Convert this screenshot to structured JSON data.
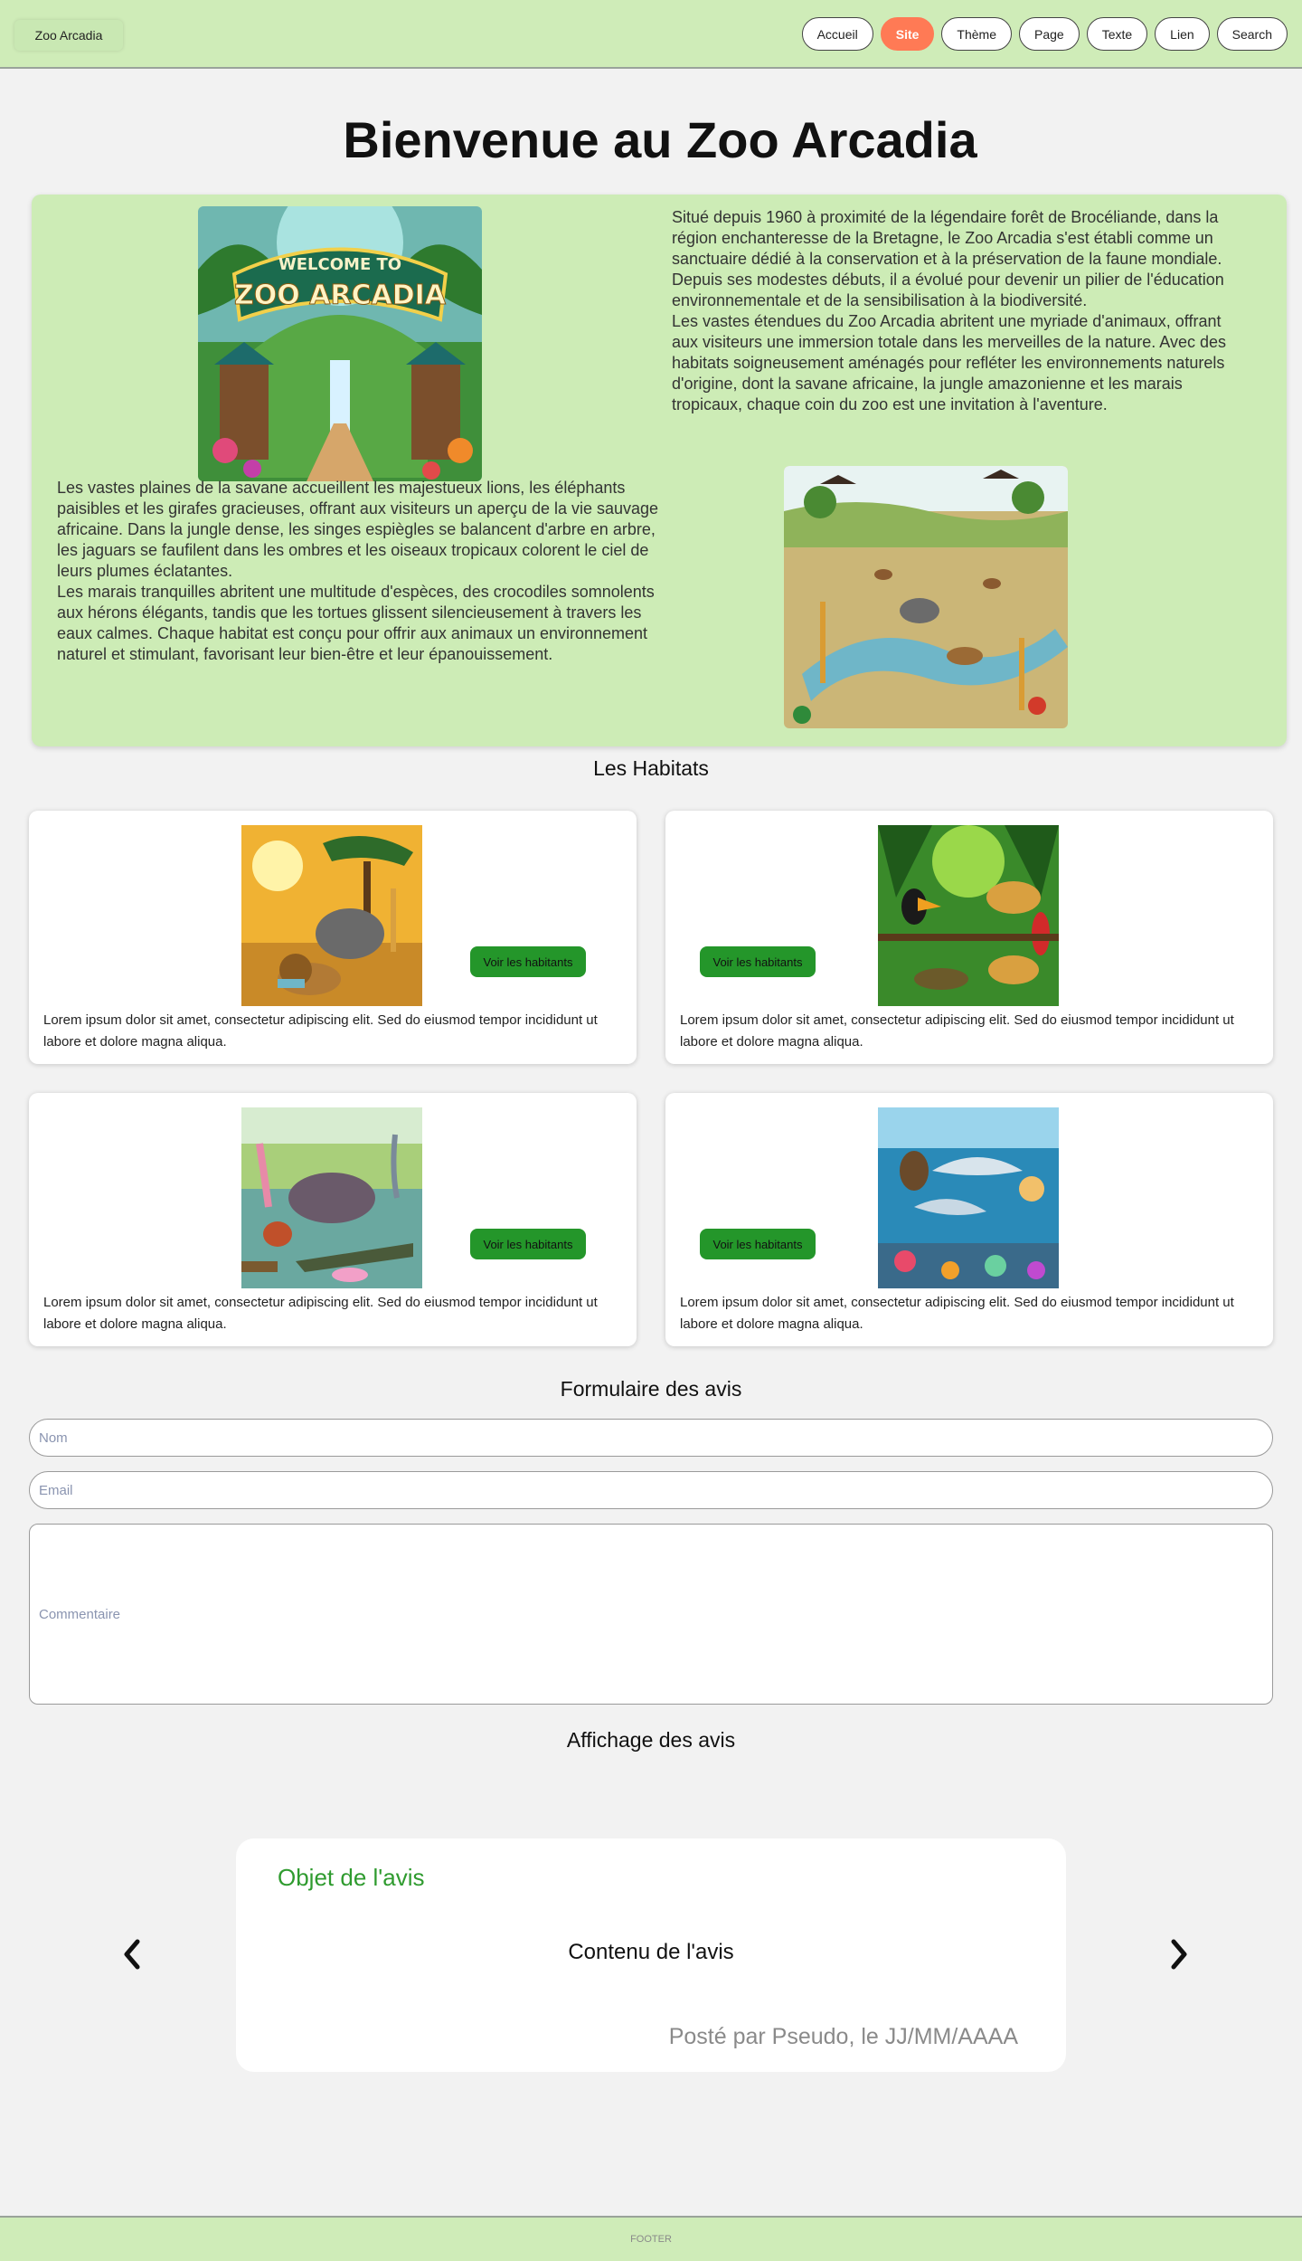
{
  "header": {
    "brand": "Zoo Arcadia",
    "nav": [
      "Accueil",
      "Site",
      "Thème",
      "Page",
      "Texte",
      "Lien",
      "Search"
    ],
    "active_index": 1
  },
  "page_title": "Bienvenue au Zoo Arcadia",
  "intro": {
    "paragraph_1": "Situé depuis 1960 à proximité de la légendaire forêt de Brocéliande, dans la région enchanteresse de la Bretagne, le Zoo Arcadia s'est établi comme un sanctuaire dédié à la conservation et à la préservation de la faune mondiale. Depuis ses modestes débuts, il a évolué pour devenir un pilier de l'éducation environnementale et de la sensibilisation à la biodiversité.\nLes vastes étendues du Zoo Arcadia abritent une myriade d'animaux, offrant aux visiteurs une immersion totale dans les merveilles de la nature. Avec des habitats soigneusement aménagés pour refléter les environnements naturels d'origine, dont la savane africaine, la jungle amazonienne et les marais tropicaux, chaque coin du zoo est une invitation à l'aventure.",
    "paragraph_2": "Les vastes plaines de la savane accueillent les majestueux lions, les éléphants paisibles et les girafes gracieuses, offrant aux visiteurs un aperçu de la vie sauvage africaine. Dans la jungle dense, les singes espiègles se balancent d'arbre en arbre, les jaguars se faufilent dans les ombres et les oiseaux tropicaux colorent le ciel de leurs plumes éclatantes.\nLes marais tranquilles abritent une multitude d'espèces, des crocodiles somnolents aux hérons élégants, tandis que les tortues glissent silencieusement à travers les eaux calmes. Chaque habitat est conçu pour offrir aux animaux un environnement naturel et stimulant, favorisant leur bien-être et leur épanouissement.",
    "sign_text_top": "WELCOME TO",
    "sign_text_main": "ZOO ARCADIA"
  },
  "habitats": {
    "title": "Les Habitats",
    "button_label": "Voir les habitants",
    "cards": [
      {
        "desc": "Lorem ipsum dolor sit amet, consectetur adipiscing elit. Sed do eiusmod tempor incididunt ut labore et dolore magna aliqua."
      },
      {
        "desc": "Lorem ipsum dolor sit amet, consectetur adipiscing elit. Sed do eiusmod tempor incididunt ut labore et dolore magna aliqua."
      },
      {
        "desc": "Lorem ipsum dolor sit amet, consectetur adipiscing elit. Sed do eiusmod tempor incididunt ut labore et dolore magna aliqua."
      },
      {
        "desc": "Lorem ipsum dolor sit amet, consectetur adipiscing elit. Sed do eiusmod tempor incididunt ut labore et dolore magna aliqua."
      }
    ]
  },
  "form": {
    "title": "Formulaire des avis",
    "name_placeholder": "Nom",
    "email_placeholder": "Email",
    "comment_placeholder": "Commentaire"
  },
  "reviews": {
    "title": "Affichage des avis",
    "subject": "Objet de l'avis",
    "content": "Contenu de l'avis",
    "meta": "Posté par Pseudo, le JJ/MM/AAAA"
  },
  "footer": "FOOTER",
  "colors": {
    "header_bg": "#cfecb8",
    "accent_active": "#ff7a55",
    "button_green": "#24962a",
    "subject_green": "#2f9b2f"
  }
}
